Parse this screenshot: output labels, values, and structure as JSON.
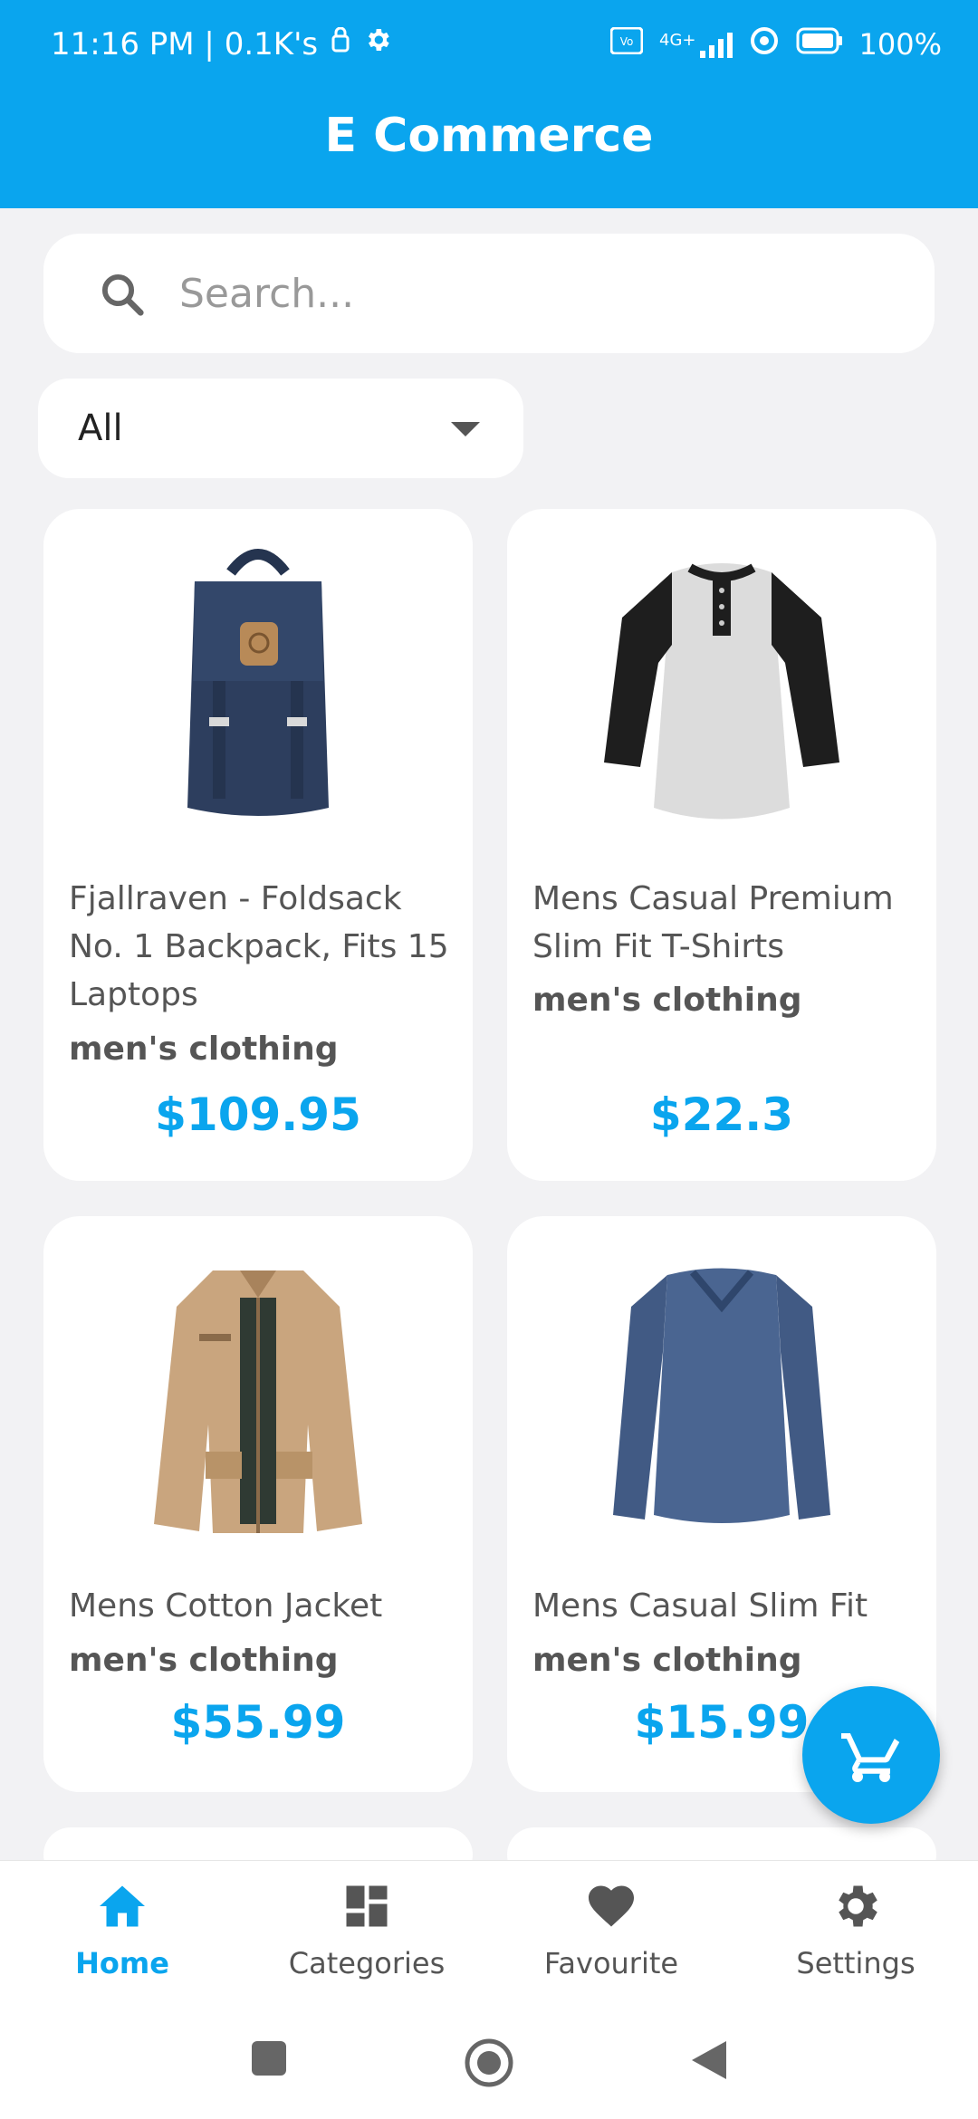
{
  "status_bar": {
    "time_speed": "11:16 PM | 0.1K's",
    "network": "4G+",
    "battery": "100%"
  },
  "header": {
    "title": "E Commerce"
  },
  "search": {
    "placeholder": "Search..."
  },
  "filter": {
    "selected": "All"
  },
  "products": [
    {
      "title": "Fjallraven - Foldsack No. 1 Backpack, Fits 15 Laptops",
      "category": "men's clothing",
      "price": "$109.95",
      "image_icon": "backpack-icon"
    },
    {
      "title": "Mens Casual Premium Slim Fit T-Shirts",
      "category": "men's clothing",
      "price": "$22.3",
      "image_icon": "tshirt-icon"
    },
    {
      "title": "Mens Cotton Jacket",
      "category": "men's clothing",
      "price": "$55.99",
      "image_icon": "jacket-icon"
    },
    {
      "title": "Mens Casual Slim Fit",
      "category": "men's clothing",
      "price": "$15.99",
      "image_icon": "longsleeve-icon"
    }
  ],
  "bottom_nav": {
    "home": "Home",
    "categories": "Categories",
    "favourite": "Favourite",
    "settings": "Settings"
  },
  "colors": {
    "accent": "#0AA5EE",
    "background": "#F2F2F4",
    "text": "#555555"
  }
}
